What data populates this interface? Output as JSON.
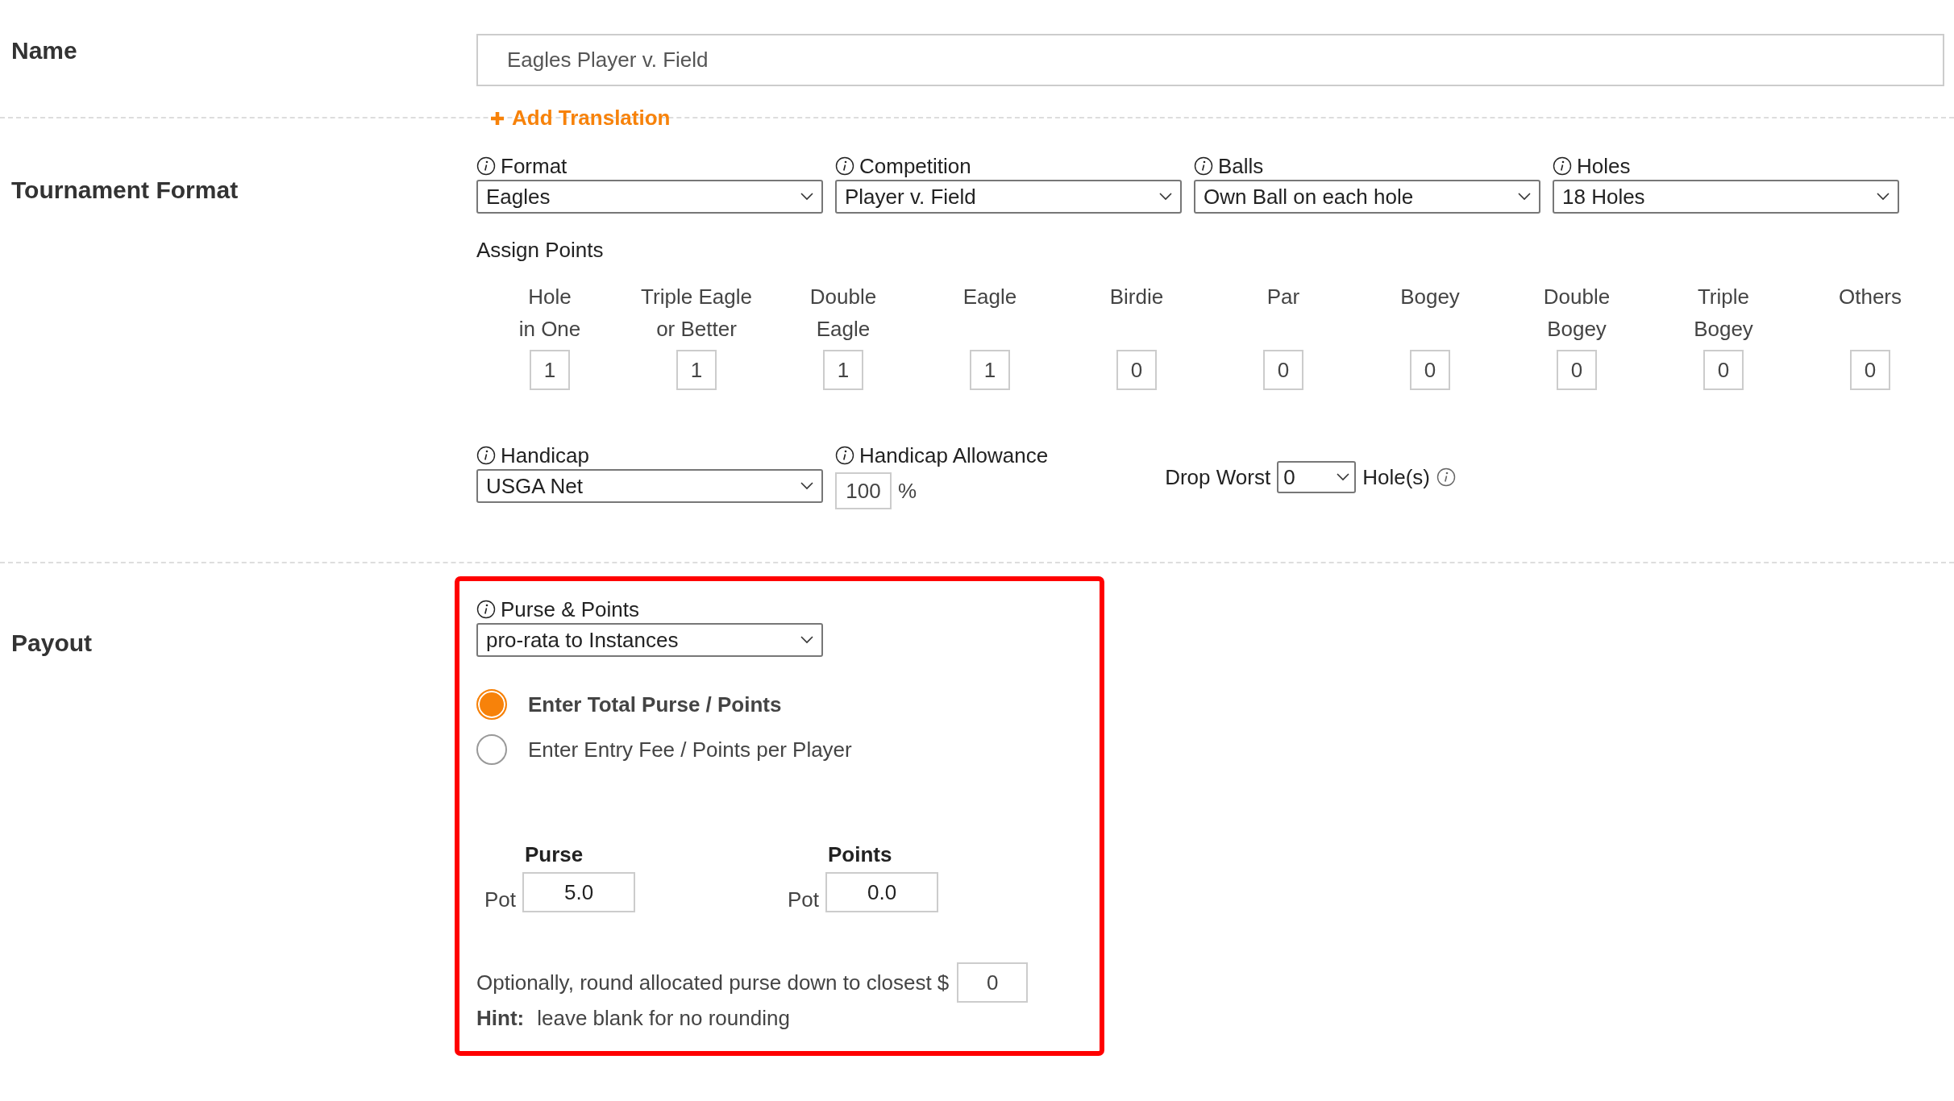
{
  "name_section": {
    "label": "Name",
    "value": "Eagles Player v. Field",
    "add_translation": "Add Translation"
  },
  "tournament_format": {
    "label": "Tournament Format",
    "selects": [
      {
        "label": "Format",
        "value": "Eagles"
      },
      {
        "label": "Competition",
        "value": "Player v. Field"
      },
      {
        "label": "Balls",
        "value": "Own Ball on each hole"
      },
      {
        "label": "Holes",
        "value": "18 Holes"
      }
    ],
    "assign_points": {
      "title": "Assign Points",
      "columns": [
        {
          "label": [
            "Hole",
            "in One"
          ],
          "value": "1"
        },
        {
          "label": [
            "Triple Eagle",
            "or Better"
          ],
          "value": "1"
        },
        {
          "label": [
            "Double",
            "Eagle"
          ],
          "value": "1"
        },
        {
          "label": [
            "Eagle"
          ],
          "value": "1"
        },
        {
          "label": [
            "Birdie"
          ],
          "value": "0"
        },
        {
          "label": [
            "Par"
          ],
          "value": "0"
        },
        {
          "label": [
            "Bogey"
          ],
          "value": "0"
        },
        {
          "label": [
            "Double",
            "Bogey"
          ],
          "value": "0"
        },
        {
          "label": [
            "Triple",
            "Bogey"
          ],
          "value": "0"
        },
        {
          "label": [
            "Others"
          ],
          "value": "0"
        }
      ]
    },
    "handicap": {
      "label": "Handicap",
      "value": "USGA Net"
    },
    "allowance": {
      "label": "Handicap Allowance",
      "value": "100",
      "unit": "%"
    },
    "drop_worst": {
      "label": "Drop Worst",
      "value": "0",
      "suffix": "Hole(s)"
    }
  },
  "payout": {
    "label": "Payout",
    "purse_points": {
      "label": "Purse & Points",
      "value": "pro-rata to Instances"
    },
    "radios": [
      {
        "label": "Enter Total Purse / Points",
        "selected": true
      },
      {
        "label": "Enter Entry Fee / Points per Player",
        "selected": false
      }
    ],
    "pots": [
      {
        "title": "Purse",
        "pot_label": "Pot",
        "value": "5.0"
      },
      {
        "title": "Points",
        "pot_label": "Pot",
        "value": "0.0"
      }
    ],
    "rounding": {
      "text": "Optionally, round allocated purse down to closest $",
      "value": "0"
    },
    "hint": {
      "label": "Hint:",
      "text": "leave blank for no rounding"
    }
  }
}
